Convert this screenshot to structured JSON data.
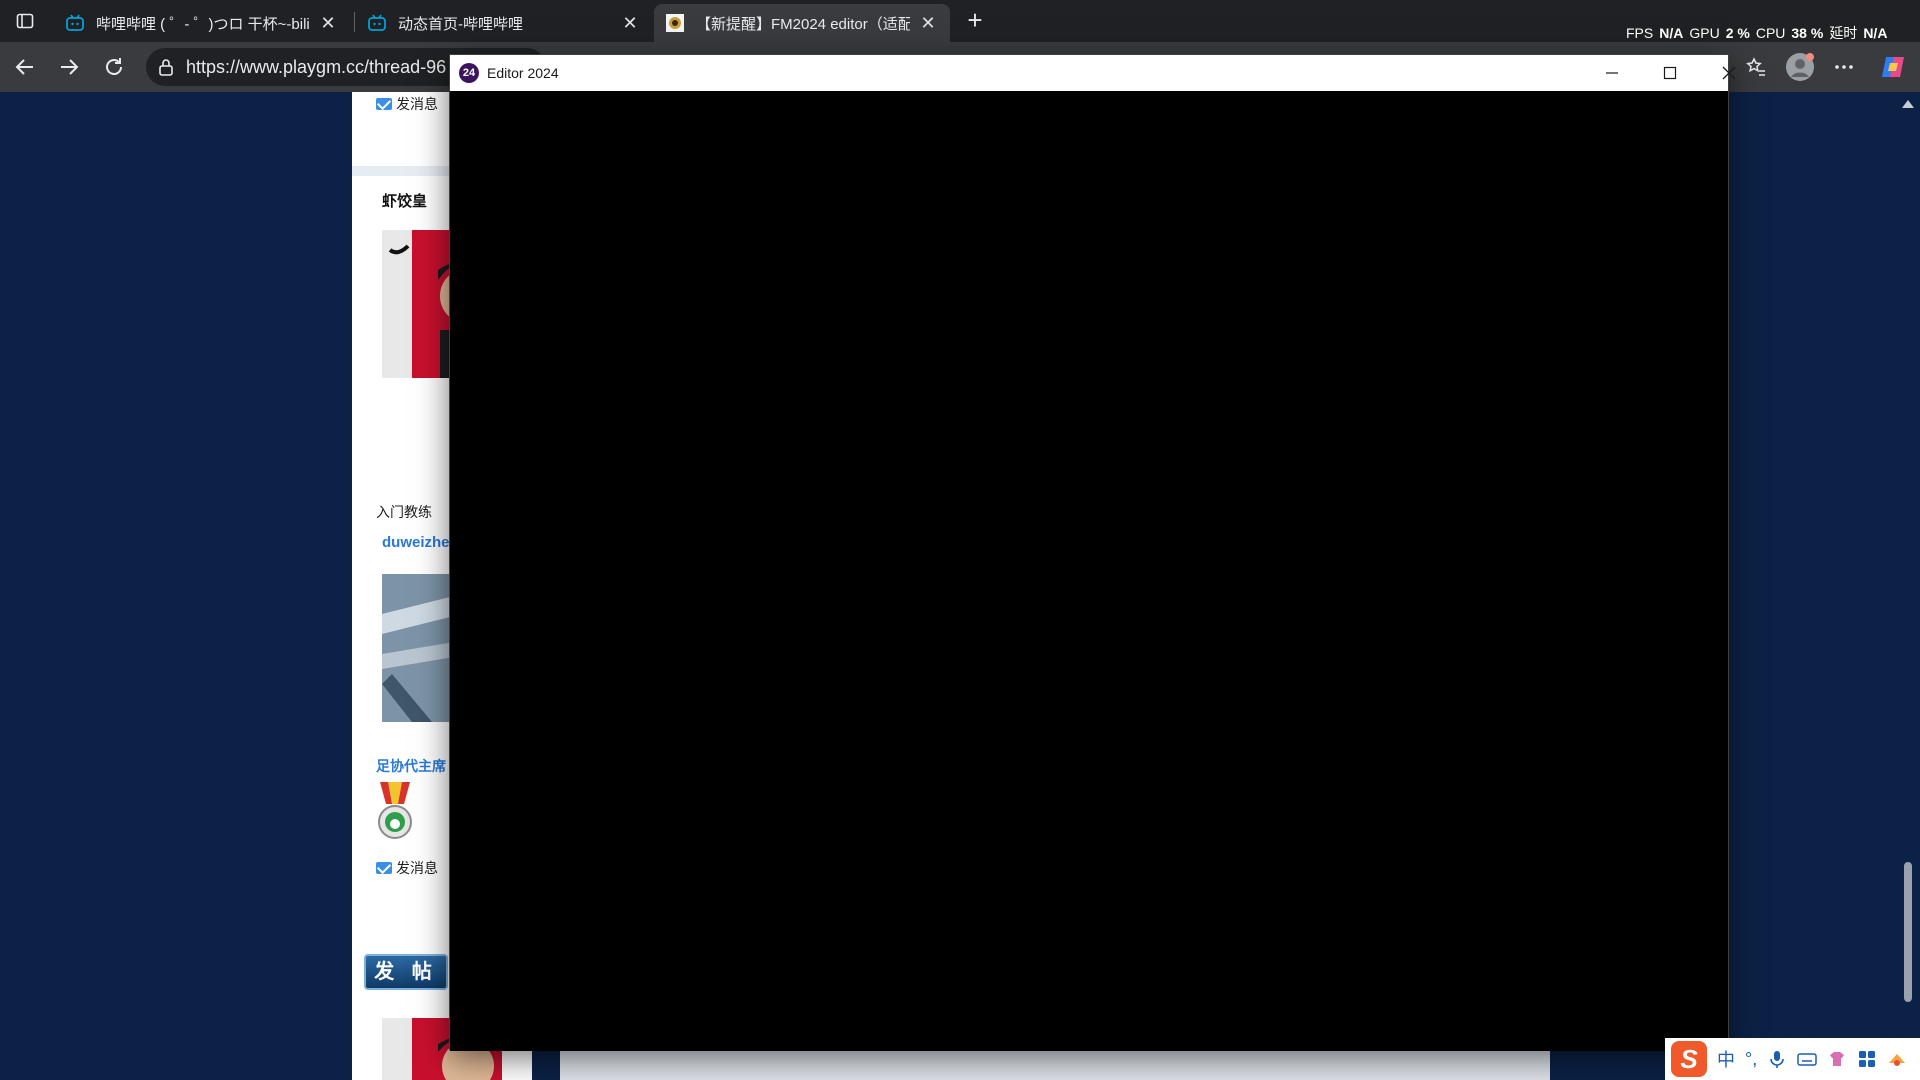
{
  "browser": {
    "tabs": [
      {
        "title": "哔哩哔哩 ( ゜- ゜)つロ 干杯~-bilibili",
        "active": false
      },
      {
        "title": "动态首页-哔哩哔哩",
        "active": false
      },
      {
        "title": "【新提醒】FM2024 editor（适配",
        "active": true
      }
    ],
    "perf": {
      "fps_label": "FPS",
      "fps_value": "N/A",
      "gpu_label": "GPU",
      "gpu_value": "2 %",
      "cpu_label": "CPU",
      "cpu_value": "38 %",
      "latency_label": "延时",
      "latency_value": "N/A"
    },
    "address": "https://www.playgm.cc/thread-96"
  },
  "forum": {
    "send_message": "发消息",
    "users": [
      {
        "name": "虾饺皇",
        "rank": "入门教练"
      },
      {
        "name": "duweizhe",
        "rank": "足协代主席"
      }
    ],
    "post_button": "发 帖"
  },
  "editor": {
    "title": "Editor 2024",
    "icon_text": "24"
  },
  "tray": {
    "ime_lang": "中",
    "ime_punct": "°,"
  },
  "colors": {
    "page_bg": "#0b2246",
    "chrome_dark": "#202124",
    "chrome_toolbar": "#3a3b3e",
    "link_blue": "#3a8ee6",
    "sogou_orange": "#f05a2a"
  }
}
